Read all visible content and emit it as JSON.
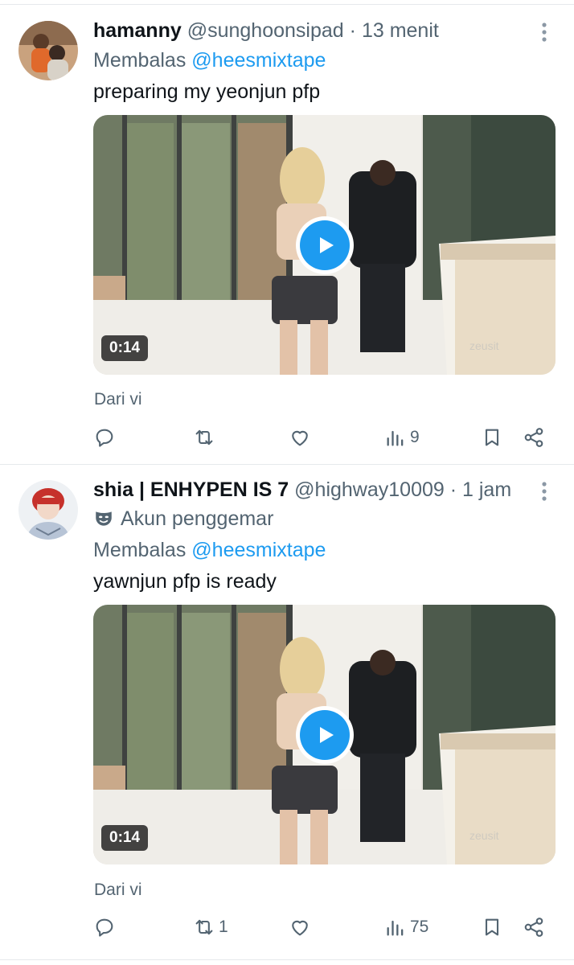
{
  "colors": {
    "accent": "#1d9bf0",
    "secondary_text": "#536471",
    "text": "#0f1419"
  },
  "tweets": [
    {
      "display_name": "hamanny",
      "handle": "@sunghoonsipad",
      "separator": "·",
      "time": "13 menit",
      "reply_prefix": "Membalas",
      "reply_mention": "@heesmixtape",
      "text": "preparing my yeonjun pfp",
      "media": {
        "duration": "0:14",
        "watermark": "zeusit"
      },
      "source": "Dari vi",
      "stats": {
        "replies": "",
        "retweets": "",
        "likes": "",
        "views": "9"
      },
      "icons": [
        "reply-icon",
        "retweet-icon",
        "like-icon",
        "views-icon",
        "bookmark-icon",
        "share-icon"
      ]
    },
    {
      "display_name": "shia | ENHYPEN IS 7",
      "handle": "@highway10009",
      "separator": "·",
      "time": "1 jam",
      "badge": "Akun penggemar",
      "reply_prefix": "Membalas",
      "reply_mention": "@heesmixtape",
      "text": "yawnjun pfp is ready",
      "media": {
        "duration": "0:14",
        "watermark": "zeusit"
      },
      "source": "Dari vi",
      "stats": {
        "replies": "",
        "retweets": "1",
        "likes": "",
        "views": "75"
      },
      "icons": [
        "reply-icon",
        "retweet-icon",
        "like-icon",
        "views-icon",
        "bookmark-icon",
        "share-icon"
      ]
    }
  ]
}
